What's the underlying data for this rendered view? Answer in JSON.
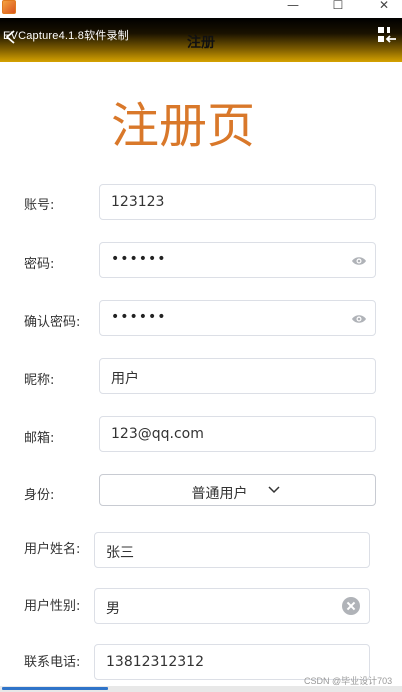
{
  "window": {
    "minimize": "—",
    "maximize": "☐",
    "close": "✕"
  },
  "header": {
    "recorder_text": "EVCapture4.1.8软件录制",
    "title": "注册"
  },
  "page_title": "注册页",
  "form": {
    "account": {
      "label": "账号:",
      "value": "123123"
    },
    "password": {
      "label": "密码:",
      "value": "••••••"
    },
    "confirm_password": {
      "label": "确认密码:",
      "value": "••••••"
    },
    "nickname": {
      "label": "昵称:",
      "value": "用户"
    },
    "email": {
      "label": "邮箱:",
      "value": "123@qq.com"
    },
    "identity": {
      "label": "身份:",
      "value": "普通用户"
    },
    "real_name": {
      "label": "用户姓名:",
      "value": "张三"
    },
    "gender": {
      "label": "用户性别:",
      "value": "男"
    },
    "phone": {
      "label": "联系电话:",
      "value": "13812312312"
    }
  },
  "credit": "CSDN @毕业设计703",
  "colors": {
    "title_accent": "#d9782a",
    "header_gradient_start": "#000000",
    "header_gradient_end": "#d6a200",
    "progress": "#2f74c9"
  }
}
